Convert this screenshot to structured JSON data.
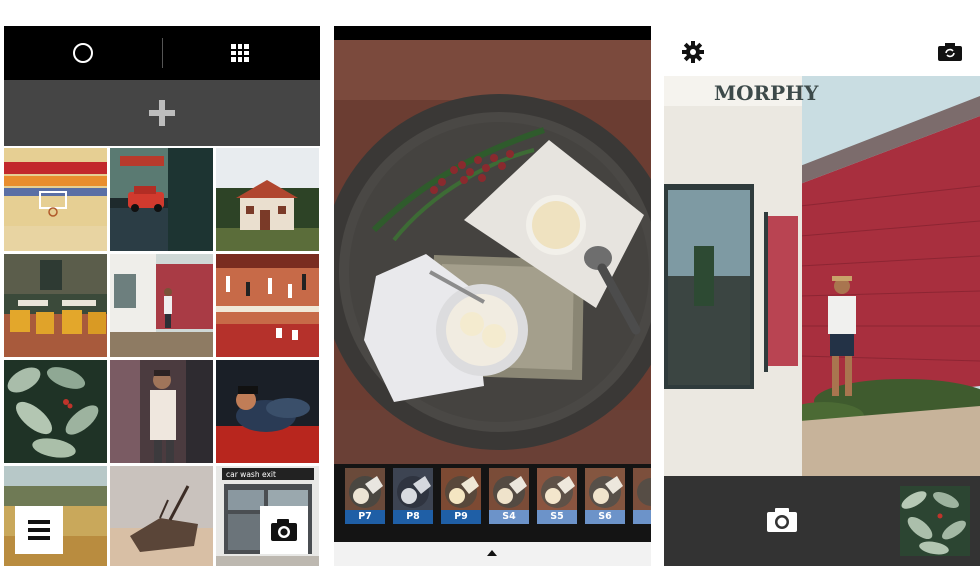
{
  "colors": {
    "topbar": "#000000",
    "add_bar": "#454545",
    "filter_label_p": "#1f5fa6",
    "filter_label_s": "#6c93c9",
    "camera_bar": "#333333"
  },
  "gallery": {
    "top_icons": [
      "camera-mode-circle-icon",
      "grid-view-icon"
    ],
    "add_icon": "plus-icon",
    "thumbnails": [
      "striped-wall-basketball-hoop",
      "red-car-by-storefront",
      "red-roofed-cottage",
      "cafe-terrace-chairs",
      "man-by-red-building",
      "basketball-court-game",
      "green-leaves-berries",
      "man-in-doorway",
      "person-lying-red-fabric",
      "golden-field-landscape",
      "boat-wreck-on-sand",
      "car-wash-building"
    ],
    "carwash_sign": "car wash   exit",
    "menu_icon": "menu-icon",
    "camera_icon": "camera-icon"
  },
  "editor": {
    "filters": [
      {
        "label": "P7",
        "group": "p"
      },
      {
        "label": "P8",
        "group": "p"
      },
      {
        "label": "P9",
        "group": "p"
      },
      {
        "label": "S4",
        "group": "s"
      },
      {
        "label": "S5",
        "group": "s"
      },
      {
        "label": "S6",
        "group": "s"
      }
    ],
    "expand_icon": "chevron-up-icon"
  },
  "camera": {
    "settings_icon": "gear-icon",
    "switch_camera_icon": "switch-camera-icon",
    "building_sign": "MORPHY",
    "shutter_icon": "camera-icon"
  }
}
